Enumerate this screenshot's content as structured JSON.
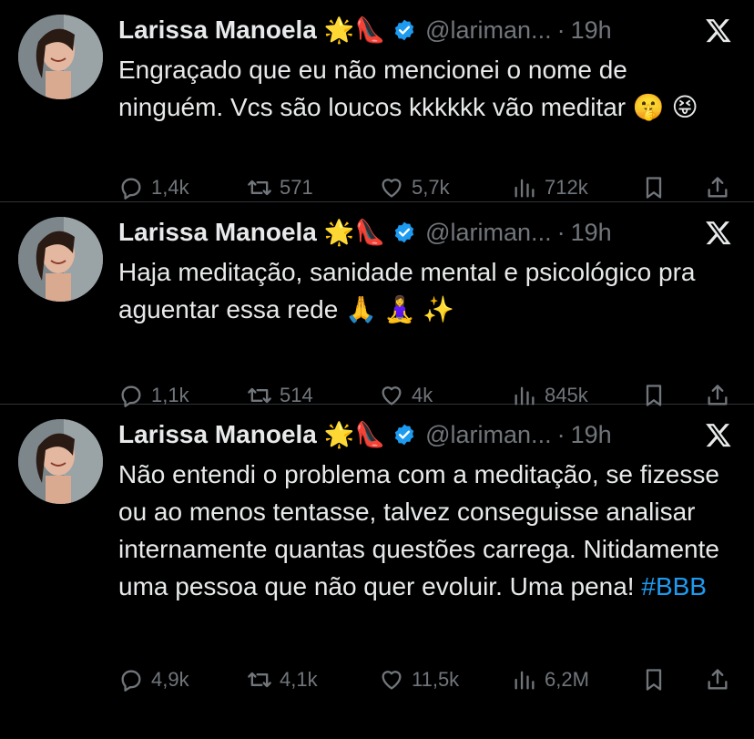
{
  "tweets": [
    {
      "author": "Larissa Manoela",
      "emojis": "🌟👠",
      "handle": "@lariman...",
      "separator": "·",
      "time": "19h",
      "text": "Engraçado que eu não mencionei o nome de ninguém. Vcs são loucos kkkkkk vão meditar 🤫 😝",
      "hashtag": "",
      "replies": "1,4k",
      "retweets": "571",
      "likes": "5,7k",
      "views": "712k"
    },
    {
      "author": "Larissa Manoela",
      "emojis": "🌟👠",
      "handle": "@lariman...",
      "separator": "·",
      "time": "19h",
      "text": "Haja meditação, sanidade mental e psicológico pra aguentar essa rede 🙏 🧘‍♀️ ✨",
      "hashtag": "",
      "replies": "1,1k",
      "retweets": "514",
      "likes": "4k",
      "views": "845k"
    },
    {
      "author": "Larissa Manoela",
      "emojis": "🌟👠",
      "handle": "@lariman...",
      "separator": "·",
      "time": "19h",
      "text": "Não entendi o problema com a meditação, se fizesse ou ao menos tentasse, talvez conseguisse analisar internamente quantas questões carrega. Nitidamente uma pessoa que não quer evoluir. Uma pena!",
      "hashtag": "#BBB",
      "replies": "4,9k",
      "retweets": "4,1k",
      "likes": "11,5k",
      "views": "6,2M"
    }
  ],
  "icons": {
    "verified": "verified-badge-icon",
    "platform": "x-logo-icon",
    "reply": "reply-icon",
    "retweet": "retweet-icon",
    "like": "heart-icon",
    "views": "views-icon",
    "bookmark": "bookmark-icon",
    "share": "share-icon"
  },
  "colors": {
    "background": "#000000",
    "text": "#e7e9ea",
    "muted": "#71767b",
    "accent": "#1d9bf0"
  }
}
